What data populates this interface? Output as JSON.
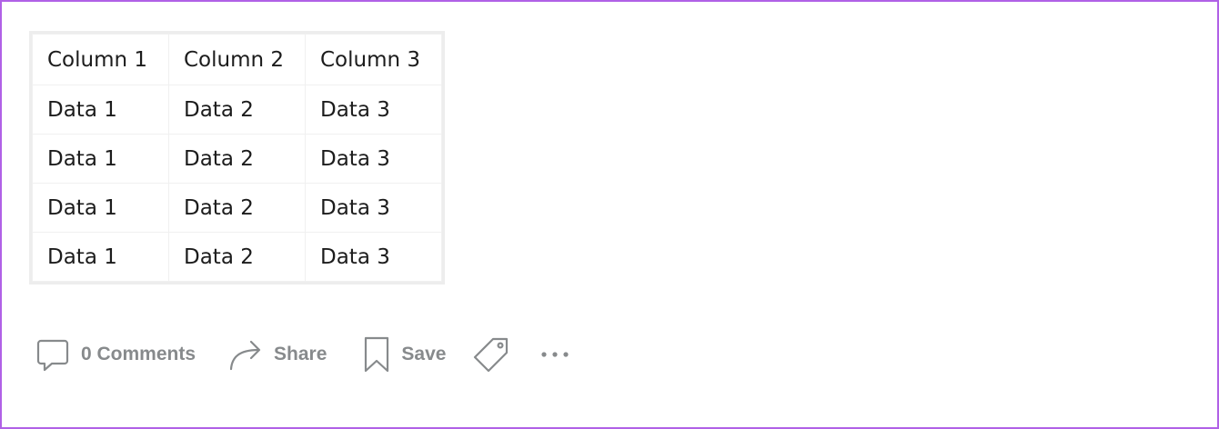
{
  "table": {
    "headers": [
      "Column 1",
      "Column 2",
      "Column 3"
    ],
    "rows": [
      [
        "Data 1",
        "Data 2",
        "Data 3"
      ],
      [
        "Data 1",
        "Data 2",
        "Data 3"
      ],
      [
        "Data 1",
        "Data 2",
        "Data 3"
      ],
      [
        "Data 1",
        "Data 2",
        "Data 3"
      ]
    ]
  },
  "actions": {
    "comments_label": "0 Comments",
    "share_label": "Share",
    "save_label": "Save"
  },
  "icons": {
    "comments": "comment-icon",
    "share": "share-arrow-icon",
    "save": "bookmark-icon",
    "tag": "tag-icon",
    "more": "more-dots-icon"
  },
  "colors": {
    "border_accent": "#b061e6",
    "action_text": "#878a8c",
    "table_border": "#ededed"
  }
}
